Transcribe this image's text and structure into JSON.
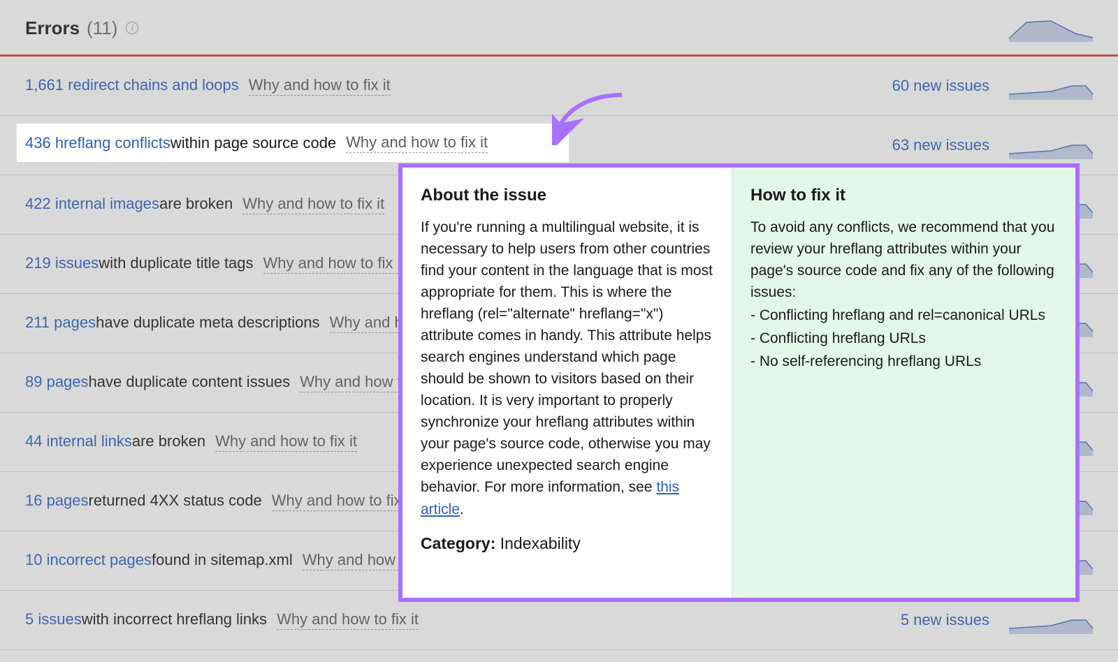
{
  "header": {
    "title": "Errors",
    "count": "(11)"
  },
  "rows": [
    {
      "blue": "1,661 redirect chains and loops",
      "black": "",
      "why": "Why and how to fix it",
      "new": "60 new issues"
    },
    {
      "blue": "436 hreflang conflicts",
      "black": " within page source code",
      "why": "Why and how to fix it",
      "new": "63 new issues"
    },
    {
      "blue": "422 internal images",
      "black": " are broken",
      "why": "Why and how to fix it",
      "new": ""
    },
    {
      "blue": "219 issues",
      "black": " with duplicate title tags",
      "why": "Why and how to fix it",
      "new": ""
    },
    {
      "blue": "211 pages",
      "black": " have duplicate meta descriptions",
      "why": "Why and how to fix it",
      "new": ""
    },
    {
      "blue": "89 pages",
      "black": " have duplicate content issues",
      "why": "Why and how to fix it",
      "new": ""
    },
    {
      "blue": "44 internal links",
      "black": " are broken",
      "why": "Why and how to fix it",
      "new": ""
    },
    {
      "blue": "16 pages",
      "black": " returned 4XX status code",
      "why": "Why and how to fix it",
      "new": ""
    },
    {
      "blue": "10 incorrect pages",
      "black": " found in sitemap.xml",
      "why": "Why and how to fix it",
      "new": ""
    },
    {
      "blue": "5 issues",
      "black": " with incorrect hreflang links",
      "why": "Why and how to fix it",
      "new": "5 new issues"
    }
  ],
  "highlight": {
    "blue": "436 hreflang conflicts",
    "black": " within page source code",
    "why": "Why and how to fix it"
  },
  "popover": {
    "about_title": "About the issue",
    "about_body_pre": "If you're running a multilingual website, it is necessary to help users from other countries find your content in the language that is most appropriate for them. This is where the hreflang (rel=\"alternate\" hreflang=\"x\") attribute comes in handy. This attribute helps search engines understand which page should be shown to visitors based on their location. It is very important to properly synchronize your hreflang attributes within your page's source code, otherwise you may experience unexpected search engine behavior. For more information, see ",
    "about_link": "this article",
    "about_body_post": ".",
    "category_label": "Category:",
    "category_value": " Indexability",
    "fix_title": "How to fix it",
    "fix_intro": "To avoid any conflicts, we recommend that you review your hreflang attributes within your page's source code and fix any of the following issues:",
    "fix_items": [
      "- Conflicting hreflang and rel=canonical URLs",
      "- Conflicting hreflang URLs",
      "- No self-referencing hreflang URLs"
    ]
  }
}
